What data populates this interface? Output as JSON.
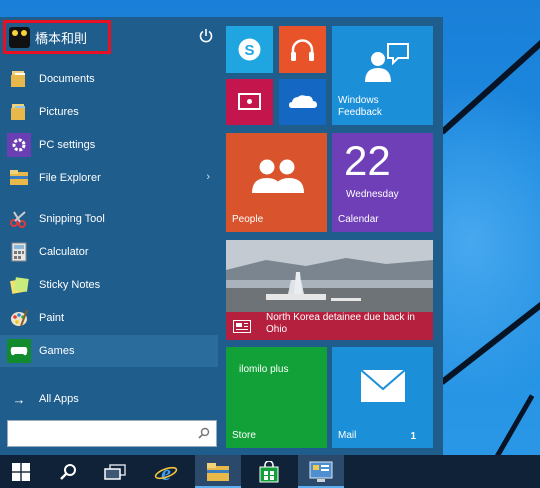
{
  "user": {
    "name": "橋本和則"
  },
  "left_menu": {
    "items": [
      {
        "label": "Documents",
        "icon": "folder-documents-icon"
      },
      {
        "label": "Pictures",
        "icon": "folder-pictures-icon"
      },
      {
        "label": "PC settings",
        "icon": "gear-icon"
      },
      {
        "label": "File Explorer",
        "icon": "file-explorer-icon"
      },
      {
        "label": "Snipping Tool",
        "icon": "scissors-icon"
      },
      {
        "label": "Calculator",
        "icon": "calculator-icon"
      },
      {
        "label": "Sticky Notes",
        "icon": "sticky-notes-icon"
      },
      {
        "label": "Paint",
        "icon": "palette-icon"
      },
      {
        "label": "Games",
        "icon": "gamepad-icon"
      }
    ],
    "all_apps": "All Apps",
    "arrow": "→",
    "chevron": "›"
  },
  "search": {
    "placeholder": ""
  },
  "tiles": {
    "feedback": {
      "label": "Windows Feedback",
      "color": "#1b8fd8"
    },
    "people": {
      "label": "People",
      "color": "#d9532c"
    },
    "calendar": {
      "day": "22",
      "weekday": "Wednesday",
      "label": "Calendar",
      "color": "#6f3fb8"
    },
    "news": {
      "headline": "North Korea detainee due back in Ohio",
      "color": "#b5203e"
    },
    "store": {
      "app_name": "ilomilo plus",
      "label": "Store",
      "color": "#12a138"
    },
    "mail": {
      "label": "Mail",
      "count": "1",
      "color": "#1b8fd8"
    },
    "skype": {
      "color": "#1fa6e0"
    },
    "music": {
      "color": "#e9532a"
    },
    "video": {
      "color": "#c4164c"
    },
    "onedrive": {
      "color": "#1567c4"
    }
  },
  "colors": {
    "start_bg": "#1f5d8c",
    "taskbar_bg": "#102238",
    "highlight": "#e81123"
  }
}
